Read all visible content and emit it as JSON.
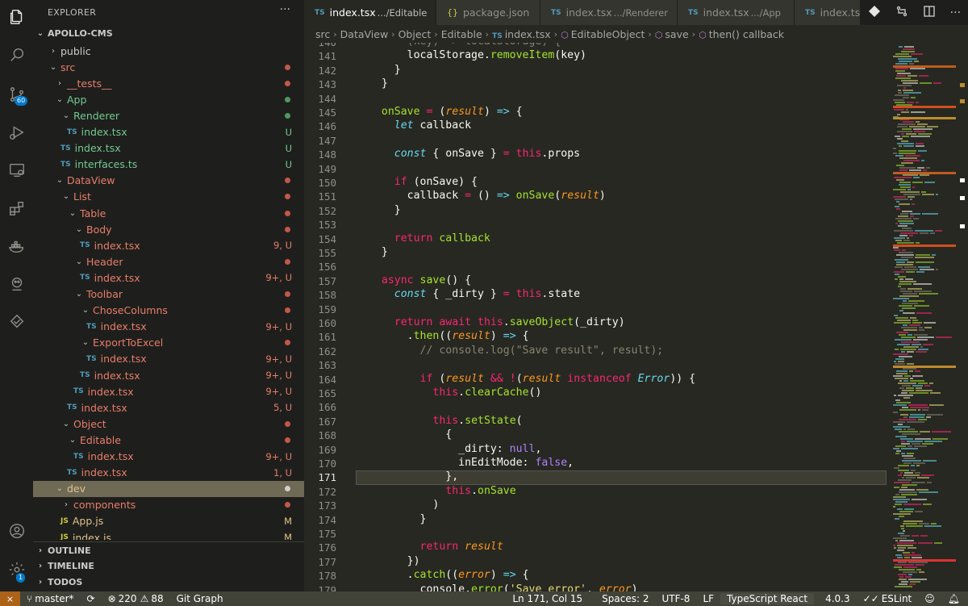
{
  "explorer": {
    "title": "EXPLORER",
    "more": "···",
    "root": "APOLLO-CMS"
  },
  "tree": [
    {
      "indent": 0,
      "type": "folder",
      "open": false,
      "name": "public",
      "color": "#cccccc",
      "status": "",
      "dot": ""
    },
    {
      "indent": 0,
      "type": "folder",
      "open": true,
      "name": "src",
      "color": "#e87d6b",
      "status": "",
      "dot": "#c4574b"
    },
    {
      "indent": 1,
      "type": "folder",
      "open": false,
      "name": "__tests__",
      "color": "#e87d6b",
      "status": "",
      "dot": "#c4574b"
    },
    {
      "indent": 1,
      "type": "folder",
      "open": true,
      "name": "App",
      "color": "#73c991",
      "status": "",
      "dot": "#4e9a5b"
    },
    {
      "indent": 2,
      "type": "folder",
      "open": true,
      "name": "Renderer",
      "color": "#73c991",
      "status": "",
      "dot": "#4e9a5b"
    },
    {
      "indent": 3,
      "type": "file",
      "icon": "TS",
      "name": "index.tsx",
      "color": "#73c991",
      "status": "U",
      "scolor": "#73c991"
    },
    {
      "indent": 2,
      "type": "file",
      "icon": "TS",
      "name": "index.tsx",
      "color": "#73c991",
      "status": "U",
      "scolor": "#73c991"
    },
    {
      "indent": 2,
      "type": "file",
      "icon": "TS",
      "name": "interfaces.ts",
      "color": "#73c991",
      "status": "U",
      "scolor": "#73c991"
    },
    {
      "indent": 1,
      "type": "folder",
      "open": true,
      "name": "DataView",
      "color": "#e87d6b",
      "status": "",
      "dot": "#c4574b"
    },
    {
      "indent": 2,
      "type": "folder",
      "open": true,
      "name": "List",
      "color": "#e87d6b",
      "status": "",
      "dot": "#c4574b"
    },
    {
      "indent": 3,
      "type": "folder",
      "open": true,
      "name": "Table",
      "color": "#e87d6b",
      "status": "",
      "dot": "#c4574b"
    },
    {
      "indent": 4,
      "type": "folder",
      "open": true,
      "name": "Body",
      "color": "#e87d6b",
      "status": "",
      "dot": "#c4574b"
    },
    {
      "indent": 5,
      "type": "file",
      "icon": "TS",
      "name": "index.tsx",
      "color": "#e87d6b",
      "status": "9, U",
      "scolor": "#e87d6b"
    },
    {
      "indent": 4,
      "type": "folder",
      "open": true,
      "name": "Header",
      "color": "#e87d6b",
      "status": "",
      "dot": "#c4574b"
    },
    {
      "indent": 5,
      "type": "file",
      "icon": "TS",
      "name": "index.tsx",
      "color": "#e87d6b",
      "status": "9+, U",
      "scolor": "#e87d6b"
    },
    {
      "indent": 4,
      "type": "folder",
      "open": true,
      "name": "Toolbar",
      "color": "#e87d6b",
      "status": "",
      "dot": "#c4574b"
    },
    {
      "indent": 5,
      "type": "folder",
      "open": true,
      "name": "ChoseColumns",
      "color": "#e87d6b",
      "status": "",
      "dot": "#c4574b"
    },
    {
      "indent": 6,
      "type": "file",
      "icon": "TS",
      "name": "index.tsx",
      "color": "#e87d6b",
      "status": "9+, U",
      "scolor": "#e87d6b"
    },
    {
      "indent": 5,
      "type": "folder",
      "open": true,
      "name": "ExportToExcel",
      "color": "#e87d6b",
      "status": "",
      "dot": "#c4574b"
    },
    {
      "indent": 6,
      "type": "file",
      "icon": "TS",
      "name": "index.tsx",
      "color": "#e87d6b",
      "status": "9+, U",
      "scolor": "#e87d6b"
    },
    {
      "indent": 5,
      "type": "file",
      "icon": "TS",
      "name": "index.tsx",
      "color": "#e87d6b",
      "status": "9+, U",
      "scolor": "#e87d6b"
    },
    {
      "indent": 4,
      "type": "file",
      "icon": "TS",
      "name": "index.tsx",
      "color": "#e87d6b",
      "status": "9+, U",
      "scolor": "#e87d6b"
    },
    {
      "indent": 3,
      "type": "file",
      "icon": "TS",
      "name": "index.tsx",
      "color": "#e87d6b",
      "status": "5, U",
      "scolor": "#e87d6b"
    },
    {
      "indent": 2,
      "type": "folder",
      "open": true,
      "name": "Object",
      "color": "#e87d6b",
      "status": "",
      "dot": "#c4574b"
    },
    {
      "indent": 3,
      "type": "folder",
      "open": true,
      "name": "Editable",
      "color": "#e87d6b",
      "status": "",
      "dot": "#c4574b"
    },
    {
      "indent": 4,
      "type": "file",
      "icon": "TS",
      "name": "index.tsx",
      "color": "#e87d6b",
      "status": "9+, U",
      "scolor": "#e87d6b"
    },
    {
      "indent": 3,
      "type": "file",
      "icon": "TS",
      "name": "index.tsx",
      "color": "#e87d6b",
      "status": "1, U",
      "scolor": "#e87d6b"
    },
    {
      "indent": 1,
      "type": "folder",
      "open": true,
      "name": "dev",
      "color": "#e2c08d",
      "status": "",
      "dot": "#cfcfcf",
      "selected": true
    },
    {
      "indent": 2,
      "type": "folder",
      "open": false,
      "name": "components",
      "color": "#e87d6b",
      "status": "",
      "dot": "#c4574b"
    },
    {
      "indent": 2,
      "type": "file",
      "icon": "JS",
      "name": "App.js",
      "color": "#e2c08d",
      "status": "M",
      "scolor": "#e2c08d"
    },
    {
      "indent": 2,
      "type": "file",
      "icon": "JS",
      "name": "index.js",
      "color": "#e2c08d",
      "status": "M",
      "scolor": "#e2c08d"
    }
  ],
  "sections": [
    "OUTLINE",
    "TIMELINE",
    "TODOS"
  ],
  "activity": {
    "scm_badge": "60",
    "account_badge": "1"
  },
  "tabs": [
    {
      "icon": "TS",
      "name": "index.tsx",
      "desc": ".../Editable",
      "active": true
    },
    {
      "icon": "{}",
      "name": "package.json",
      "desc": "",
      "active": false
    },
    {
      "icon": "TS",
      "name": "index.tsx",
      "desc": ".../Renderer",
      "active": false
    },
    {
      "icon": "TS",
      "name": "index.tsx",
      "desc": ".../App",
      "active": false
    },
    {
      "icon": "TS",
      "name": "index.tsx",
      "desc": "",
      "active": false
    }
  ],
  "breadcrumb": [
    "src",
    "DataView",
    "Object",
    "Editable",
    "index.tsx",
    "EditableObject",
    "save",
    "then() callback"
  ],
  "code": [
    {
      "n": 140,
      "t": [
        [
          "      ",
          "d"
        ],
        [
          "(key) => localStorage) {",
          "m"
        ]
      ]
    },
    {
      "n": 141,
      "t": [
        [
          "      localStorage.",
          "d"
        ],
        [
          "removeItem",
          "g"
        ],
        [
          "(key)",
          "d"
        ]
      ]
    },
    {
      "n": 142,
      "t": [
        [
          "    }",
          "d"
        ]
      ]
    },
    {
      "n": 143,
      "t": [
        [
          "  }",
          "d"
        ]
      ]
    },
    {
      "n": 144,
      "t": [
        [
          "",
          "d"
        ]
      ]
    },
    {
      "n": 145,
      "t": [
        [
          "  onSave ",
          "g"
        ],
        [
          "= ",
          "p"
        ],
        [
          "(",
          "d"
        ],
        [
          "result",
          "oi"
        ],
        [
          ") ",
          "d"
        ],
        [
          "=>",
          "c"
        ],
        [
          " {",
          "d"
        ]
      ]
    },
    {
      "n": 146,
      "t": [
        [
          "    ",
          "d"
        ],
        [
          "let",
          "ci"
        ],
        [
          " callback",
          "d"
        ]
      ]
    },
    {
      "n": 147,
      "t": [
        [
          "",
          "d"
        ]
      ]
    },
    {
      "n": 148,
      "t": [
        [
          "    ",
          "d"
        ],
        [
          "const",
          "ci"
        ],
        [
          " { onSave } ",
          "d"
        ],
        [
          "=",
          "p"
        ],
        [
          " ",
          "d"
        ],
        [
          "this",
          "p"
        ],
        [
          ".",
          "d"
        ],
        [
          "props",
          "d"
        ]
      ]
    },
    {
      "n": 149,
      "t": [
        [
          "",
          "d"
        ]
      ]
    },
    {
      "n": 150,
      "t": [
        [
          "    ",
          "d"
        ],
        [
          "if",
          "p"
        ],
        [
          " (onSave) {",
          "d"
        ]
      ]
    },
    {
      "n": 151,
      "t": [
        [
          "      callback ",
          "d"
        ],
        [
          "=",
          "p"
        ],
        [
          " () ",
          "d"
        ],
        [
          "=>",
          "c"
        ],
        [
          " ",
          "d"
        ],
        [
          "onSave",
          "g"
        ],
        [
          "(",
          "d"
        ],
        [
          "result",
          "oi"
        ],
        [
          ")",
          "d"
        ]
      ]
    },
    {
      "n": 152,
      "t": [
        [
          "    }",
          "d"
        ]
      ]
    },
    {
      "n": 153,
      "t": [
        [
          "",
          "d"
        ]
      ]
    },
    {
      "n": 154,
      "t": [
        [
          "    ",
          "d"
        ],
        [
          "return",
          "p"
        ],
        [
          " callback",
          "g"
        ]
      ]
    },
    {
      "n": 155,
      "t": [
        [
          "  }",
          "d"
        ]
      ]
    },
    {
      "n": 156,
      "t": [
        [
          "",
          "d"
        ]
      ]
    },
    {
      "n": 157,
      "t": [
        [
          "  ",
          "d"
        ],
        [
          "async",
          "p"
        ],
        [
          " ",
          "d"
        ],
        [
          "save",
          "g"
        ],
        [
          "() {",
          "d"
        ]
      ]
    },
    {
      "n": 158,
      "t": [
        [
          "    ",
          "d"
        ],
        [
          "const",
          "ci"
        ],
        [
          " { _dirty } ",
          "d"
        ],
        [
          "=",
          "p"
        ],
        [
          " ",
          "d"
        ],
        [
          "this",
          "p"
        ],
        [
          ".",
          "d"
        ],
        [
          "state",
          "d"
        ]
      ]
    },
    {
      "n": 159,
      "t": [
        [
          "",
          "d"
        ]
      ]
    },
    {
      "n": 160,
      "t": [
        [
          "    ",
          "d"
        ],
        [
          "return",
          "p"
        ],
        [
          " ",
          "d"
        ],
        [
          "await",
          "p"
        ],
        [
          " ",
          "d"
        ],
        [
          "this",
          "p"
        ],
        [
          ".",
          "d"
        ],
        [
          "saveObject",
          "g"
        ],
        [
          "(_dirty)",
          "d"
        ]
      ]
    },
    {
      "n": 161,
      "t": [
        [
          "      .",
          "d"
        ],
        [
          "then",
          "g"
        ],
        [
          "((",
          "d"
        ],
        [
          "result",
          "oi"
        ],
        [
          ") ",
          "d"
        ],
        [
          "=>",
          "c"
        ],
        [
          " {",
          "d"
        ]
      ]
    },
    {
      "n": 162,
      "t": [
        [
          "        // console.log(\"Save result\", result);",
          "m"
        ]
      ]
    },
    {
      "n": 163,
      "t": [
        [
          "",
          "d"
        ]
      ]
    },
    {
      "n": 164,
      "t": [
        [
          "        ",
          "d"
        ],
        [
          "if",
          "p"
        ],
        [
          " (",
          "d"
        ],
        [
          "result",
          "oi"
        ],
        [
          " ",
          "d"
        ],
        [
          "&&",
          "p"
        ],
        [
          " ",
          "d"
        ],
        [
          "!",
          "p"
        ],
        [
          "(",
          "d"
        ],
        [
          "result",
          "oi"
        ],
        [
          " ",
          "d"
        ],
        [
          "instanceof",
          "p"
        ],
        [
          " ",
          "d"
        ],
        [
          "Error",
          "ci"
        ],
        [
          ")) {",
          "d"
        ]
      ]
    },
    {
      "n": 165,
      "t": [
        [
          "          ",
          "d"
        ],
        [
          "this",
          "p"
        ],
        [
          ".",
          "d"
        ],
        [
          "clearCache",
          "g"
        ],
        [
          "()",
          "d"
        ]
      ]
    },
    {
      "n": 166,
      "t": [
        [
          "",
          "d"
        ]
      ]
    },
    {
      "n": 167,
      "t": [
        [
          "          ",
          "d"
        ],
        [
          "this",
          "p"
        ],
        [
          ".",
          "d"
        ],
        [
          "setState",
          "g"
        ],
        [
          "(",
          "d"
        ]
      ]
    },
    {
      "n": 168,
      "t": [
        [
          "            {",
          "d"
        ]
      ]
    },
    {
      "n": 169,
      "t": [
        [
          "              _dirty: ",
          "d"
        ],
        [
          "null",
          "v"
        ],
        [
          ",",
          "d"
        ]
      ]
    },
    {
      "n": 170,
      "t": [
        [
          "              inEditMode: ",
          "d"
        ],
        [
          "false",
          "v"
        ],
        [
          ",",
          "d"
        ]
      ]
    },
    {
      "n": 171,
      "t": [
        [
          "            },",
          "d"
        ]
      ]
    },
    {
      "n": 172,
      "t": [
        [
          "            ",
          "d"
        ],
        [
          "this",
          "p"
        ],
        [
          ".",
          "d"
        ],
        [
          "onSave",
          "g"
        ]
      ]
    },
    {
      "n": 173,
      "t": [
        [
          "          )",
          "d"
        ]
      ]
    },
    {
      "n": 174,
      "t": [
        [
          "        }",
          "d"
        ]
      ]
    },
    {
      "n": 175,
      "t": [
        [
          "",
          "d"
        ]
      ]
    },
    {
      "n": 176,
      "t": [
        [
          "        ",
          "d"
        ],
        [
          "return",
          "p"
        ],
        [
          " ",
          "d"
        ],
        [
          "result",
          "oi"
        ]
      ]
    },
    {
      "n": 177,
      "t": [
        [
          "      })",
          "d"
        ]
      ]
    },
    {
      "n": 178,
      "t": [
        [
          "      .",
          "d"
        ],
        [
          "catch",
          "g"
        ],
        [
          "((",
          "d"
        ],
        [
          "error",
          "oi"
        ],
        [
          ") ",
          "d"
        ],
        [
          "=>",
          "c"
        ],
        [
          " {",
          "d"
        ]
      ]
    },
    {
      "n": 179,
      "t": [
        [
          "        console.",
          "d"
        ],
        [
          "error",
          "g"
        ],
        [
          "(",
          "d"
        ],
        [
          "'Save error'",
          "y"
        ],
        [
          ", ",
          "d"
        ],
        [
          "error",
          "oi"
        ],
        [
          ")",
          "d"
        ]
      ]
    }
  ],
  "status": {
    "branch": "master*",
    "errors": "220",
    "warnings": "88",
    "git_graph": "Git Graph",
    "position": "Ln 171, Col 15",
    "spaces": "Spaces: 2",
    "encoding": "UTF-8",
    "eol": "LF",
    "language": "TypeScript React",
    "version": "4.0.3",
    "eslint": "ESLint"
  },
  "colors": {
    "editor_bg": "#272822",
    "sidebar_bg": "#1e1f1c",
    "status_bg": "#414339",
    "remote_bg": "#ac6218"
  }
}
